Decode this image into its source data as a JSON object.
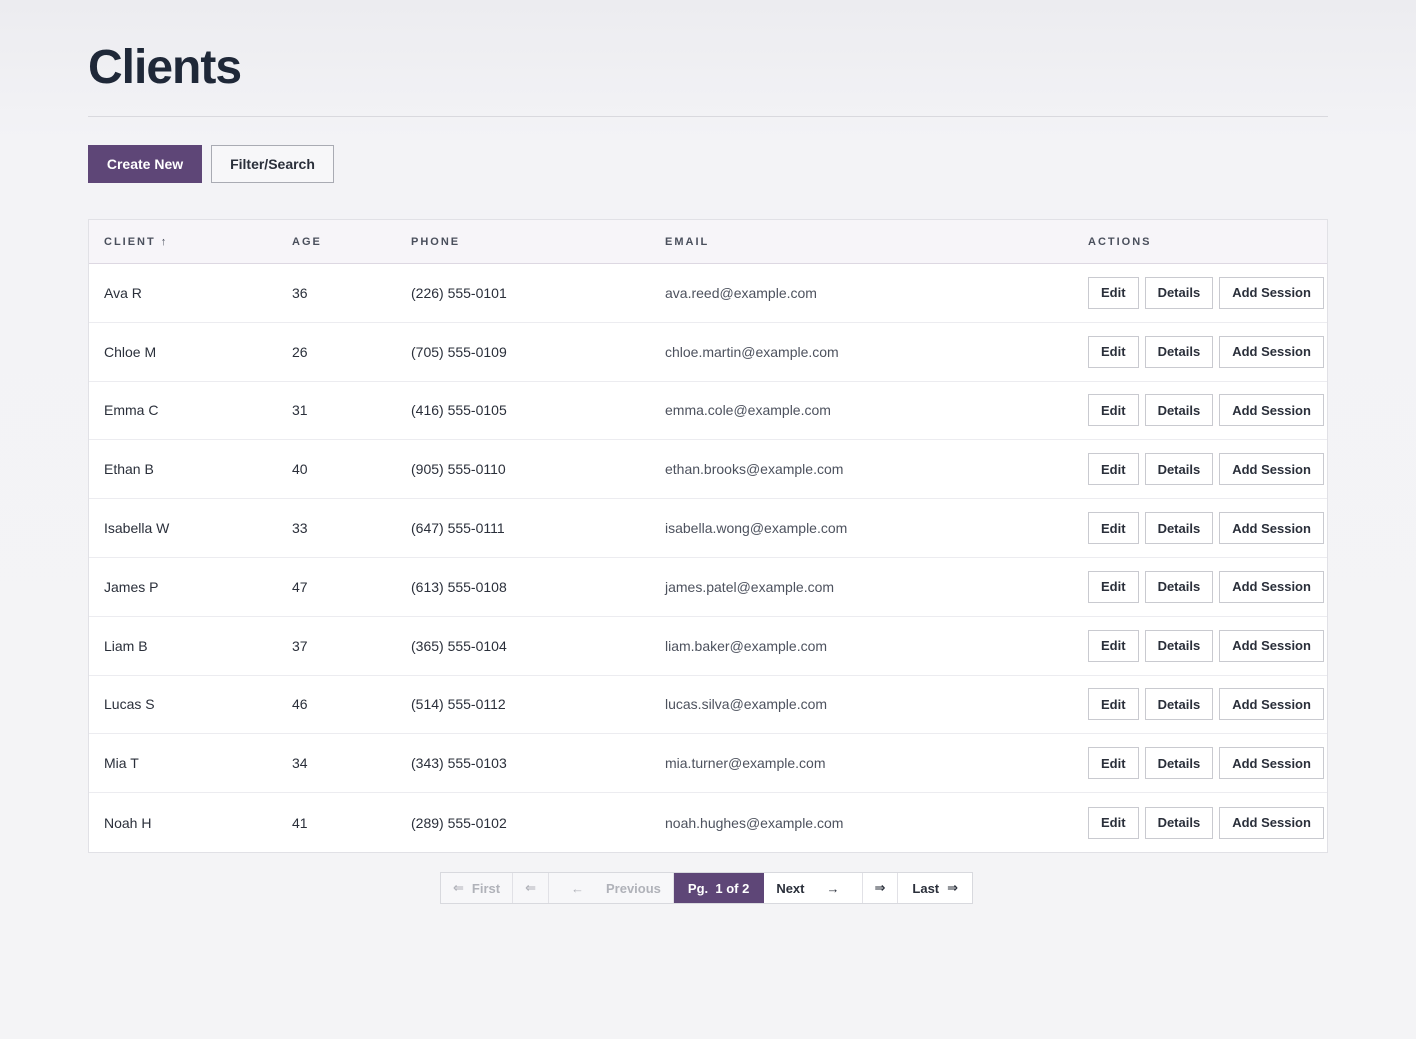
{
  "page": {
    "title": "Clients"
  },
  "toolbar": {
    "create_label": "Create New",
    "filter_label": "Filter/Search"
  },
  "table": {
    "headers": {
      "client": "CLIENT ↑",
      "age": "AGE",
      "phone": "PHONE",
      "email": "EMAIL",
      "actions": "ACTIONS"
    },
    "action_labels": {
      "edit": "Edit",
      "details": "Details",
      "add_session": "Add Session"
    },
    "rows": [
      {
        "client": "Ava R",
        "age": "36",
        "phone": "(226) 555-0101",
        "email": "ava.reed@example.com"
      },
      {
        "client": "Chloe M",
        "age": "26",
        "phone": "(705) 555-0109",
        "email": "chloe.martin@example.com"
      },
      {
        "client": "Emma C",
        "age": "31",
        "phone": "(416) 555-0105",
        "email": "emma.cole@example.com"
      },
      {
        "client": "Ethan B",
        "age": "40",
        "phone": "(905) 555-0110",
        "email": "ethan.brooks@example.com"
      },
      {
        "client": "Isabella W",
        "age": "33",
        "phone": "(647) 555-0111",
        "email": "isabella.wong@example.com"
      },
      {
        "client": "James P",
        "age": "47",
        "phone": "(613) 555-0108",
        "email": "james.patel@example.com"
      },
      {
        "client": "Liam B",
        "age": "37",
        "phone": "(365) 555-0104",
        "email": "liam.baker@example.com"
      },
      {
        "client": "Lucas S",
        "age": "46",
        "phone": "(514) 555-0112",
        "email": "lucas.silva@example.com"
      },
      {
        "client": "Mia T",
        "age": "34",
        "phone": "(343) 555-0103",
        "email": "mia.turner@example.com"
      },
      {
        "client": "Noah H",
        "age": "41",
        "phone": "(289) 555-0102",
        "email": "noah.hughes@example.com"
      }
    ]
  },
  "pagination": {
    "first_arrow": "⇐",
    "first_label": "First",
    "prev_page_arrow": "⇐",
    "prev_arrow": "←",
    "prev_label": "Previous",
    "current_label": "Pg.  1 of 2",
    "next_label": "Next",
    "next_arrow": "→",
    "next_page_arrow": "⇒",
    "last_label": "Last",
    "last_arrow": "⇒"
  },
  "colors": {
    "accent": "#5e4677"
  }
}
